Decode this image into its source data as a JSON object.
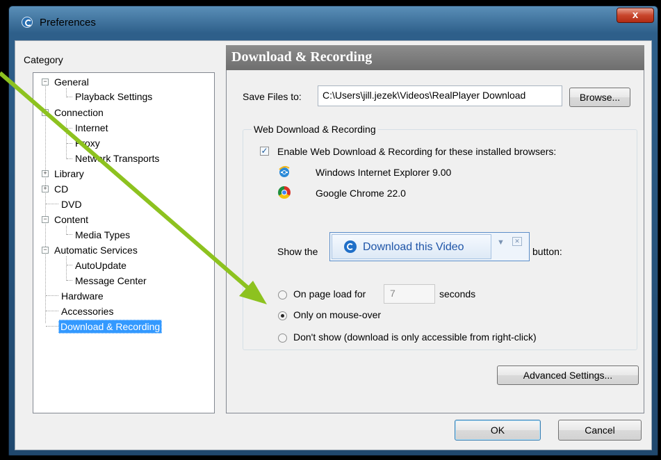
{
  "window": {
    "title": "Preferences",
    "close_glyph": "x"
  },
  "category": {
    "label": "Category",
    "tree": [
      {
        "label": "General"
      },
      {
        "label": "Playback Settings"
      },
      {
        "label": "Connection"
      },
      {
        "label": "Internet"
      },
      {
        "label": "Proxy"
      },
      {
        "label": "Network Transports"
      },
      {
        "label": "Library"
      },
      {
        "label": "CD"
      },
      {
        "label": "DVD"
      },
      {
        "label": "Content"
      },
      {
        "label": "Media Types"
      },
      {
        "label": "Automatic Services"
      },
      {
        "label": "AutoUpdate"
      },
      {
        "label": "Message Center"
      },
      {
        "label": "Hardware"
      },
      {
        "label": "Accessories"
      },
      {
        "label": "Download & Recording",
        "selected": true
      }
    ]
  },
  "panel": {
    "title": "Download & Recording",
    "save_files_label": "Save Files to:",
    "save_files_path": "C:\\Users\\jill.jezek\\Videos\\RealPlayer Download",
    "browse_label": "Browse...",
    "group_label": "Web Download & Recording",
    "enable_label": "Enable Web Download & Recording for these installed browsers:",
    "enable_checked": true,
    "browsers": [
      {
        "name": "Windows Internet Explorer 9.00",
        "icon": "internet-explorer-icon"
      },
      {
        "name": "Google Chrome 22.0",
        "icon": "chrome-icon"
      }
    ],
    "show_the_label": "Show the",
    "download_video_label": "Download this Video",
    "button_label": "button:",
    "options": {
      "page_load_label": "On page load for",
      "seconds_value": "7",
      "seconds_label": "seconds",
      "mouse_over_label": "Only on mouse-over",
      "dont_show_label": "Don't show (download is only accessible from right-click)",
      "selected": "mouse_over"
    },
    "advanced_label": "Advanced Settings..."
  },
  "footer": {
    "ok_label": "OK",
    "cancel_label": "Cancel"
  },
  "colors": {
    "selection": "#3399ff",
    "panel_header": "#7a7a7a",
    "arrow": "#8dc21f"
  }
}
